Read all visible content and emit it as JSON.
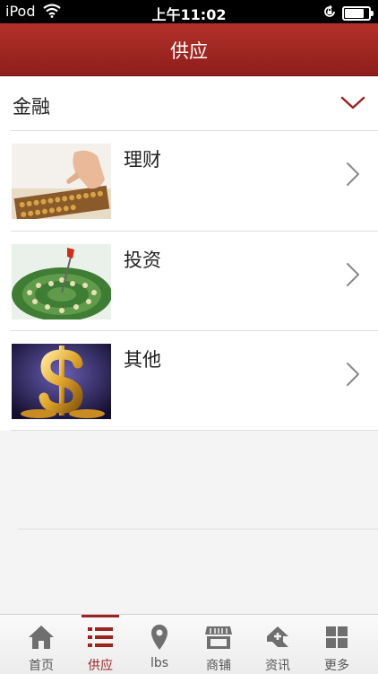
{
  "status_bar": {
    "carrier": "iPod",
    "time": "上午11:02"
  },
  "nav": {
    "title": "供应"
  },
  "category": {
    "label": "金融",
    "icon": "chevron-down-icon"
  },
  "items": [
    {
      "label": "理财",
      "image": "abacus-photo"
    },
    {
      "label": "投资",
      "image": "dart-coins-photo"
    },
    {
      "label": "其他",
      "image": "gold-dollar-photo"
    }
  ],
  "tabs": [
    {
      "label": "首页",
      "icon": "home-icon"
    },
    {
      "label": "供应",
      "icon": "list-icon",
      "active": true
    },
    {
      "label": "lbs",
      "icon": "location-pin-icon"
    },
    {
      "label": "商铺",
      "icon": "store-icon"
    },
    {
      "label": "资讯",
      "icon": "news-icon"
    },
    {
      "label": "更多",
      "icon": "grid-icon"
    }
  ],
  "colors": {
    "accent": "#9b2421",
    "nav_top": "#b3302a",
    "nav_bottom": "#8e1e1a"
  }
}
